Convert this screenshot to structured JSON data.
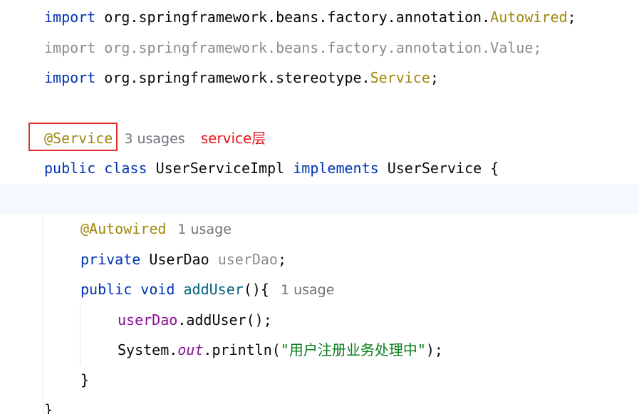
{
  "code": {
    "import1": {
      "kw": "import",
      "pkg": "org.springframework.beans.factory.annotation.",
      "name": "Autowired",
      "end": ";"
    },
    "import2": {
      "kw": "import",
      "pkg": "org.springframework.beans.factory.annotation.",
      "name": "Value",
      "end": ";"
    },
    "import3": {
      "kw": "import",
      "pkg": "org.springframework.stereotype.",
      "name": "Service",
      "end": ";"
    },
    "service_annotation": "@Service",
    "service_usages": "3 usages",
    "service_note": "service层",
    "class_decl": {
      "kw1": "public",
      "kw2": "class",
      "name": "UserServiceImpl",
      "kw3": "implements",
      "iface": "UserService",
      "brace": "{"
    },
    "autowired_annotation": "@Autowired",
    "autowired_usages": "1 usage",
    "field_decl": {
      "kw": "private",
      "type": "UserDao",
      "name": "userDao",
      "end": ";"
    },
    "method_decl": {
      "kw1": "public",
      "kw2": "void",
      "name": "addUser",
      "sig": "(){",
      "usages": "1 usage"
    },
    "call_line": {
      "field": "userDao",
      "rest": ".addUser();"
    },
    "print_line": {
      "cls": "System.",
      "field": "out",
      "mid": ".println(",
      "str": "\"用户注册业务处理中\"",
      "end": ");"
    },
    "method_close": "}",
    "class_close": "}"
  },
  "colors": {
    "keyword": "#0033b3",
    "annotation": "#9e880d",
    "field": "#871094",
    "string": "#067d17",
    "note": "#e8141b",
    "highlight_border": "#e03030"
  }
}
